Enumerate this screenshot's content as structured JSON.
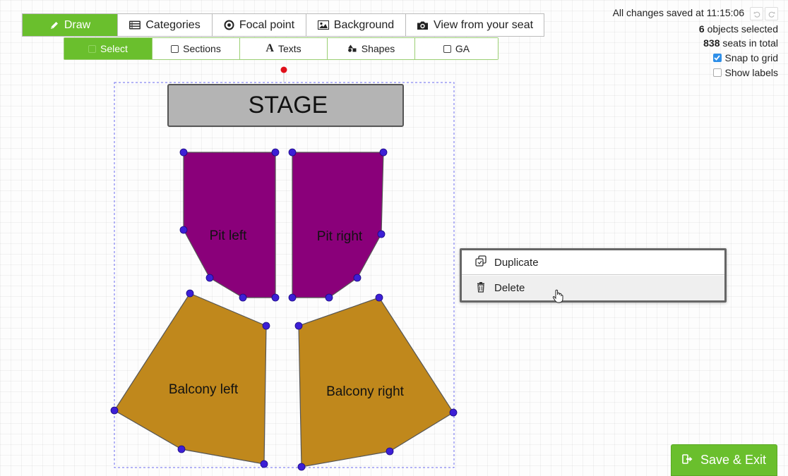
{
  "toolbar": {
    "draw": "Draw",
    "categories": "Categories",
    "focal_point": "Focal point",
    "background": "Background",
    "view_from_seat": "View from your seat"
  },
  "subtoolbar": {
    "select": "Select",
    "sections": "Sections",
    "texts": "Texts",
    "shapes": "Shapes",
    "ga": "GA"
  },
  "status": {
    "saved_text": "All changes saved at 11:15:06",
    "objects_count": "6",
    "objects_text": "objects selected",
    "seats_count": "838",
    "seats_text": "seats in total"
  },
  "options": {
    "snap_to_grid": {
      "label": "Snap to grid",
      "checked": true
    },
    "show_labels": {
      "label": "Show labels",
      "checked": false
    }
  },
  "canvas": {
    "stage_label": "STAGE",
    "sections": [
      {
        "name": "Pit left",
        "color": "#8a007a"
      },
      {
        "name": "Pit right",
        "color": "#8a007a"
      },
      {
        "name": "Balcony left",
        "color": "#c0881c"
      },
      {
        "name": "Balcony right",
        "color": "#c0881c"
      }
    ]
  },
  "context_menu": {
    "duplicate": "Duplicate",
    "delete": "Delete"
  },
  "save_exit": "Save & Exit",
  "colors": {
    "accent": "#6abf2d",
    "handle": "#3d1fd6",
    "focal": "#e0101a",
    "stage_fill": "#b4b4b4"
  }
}
